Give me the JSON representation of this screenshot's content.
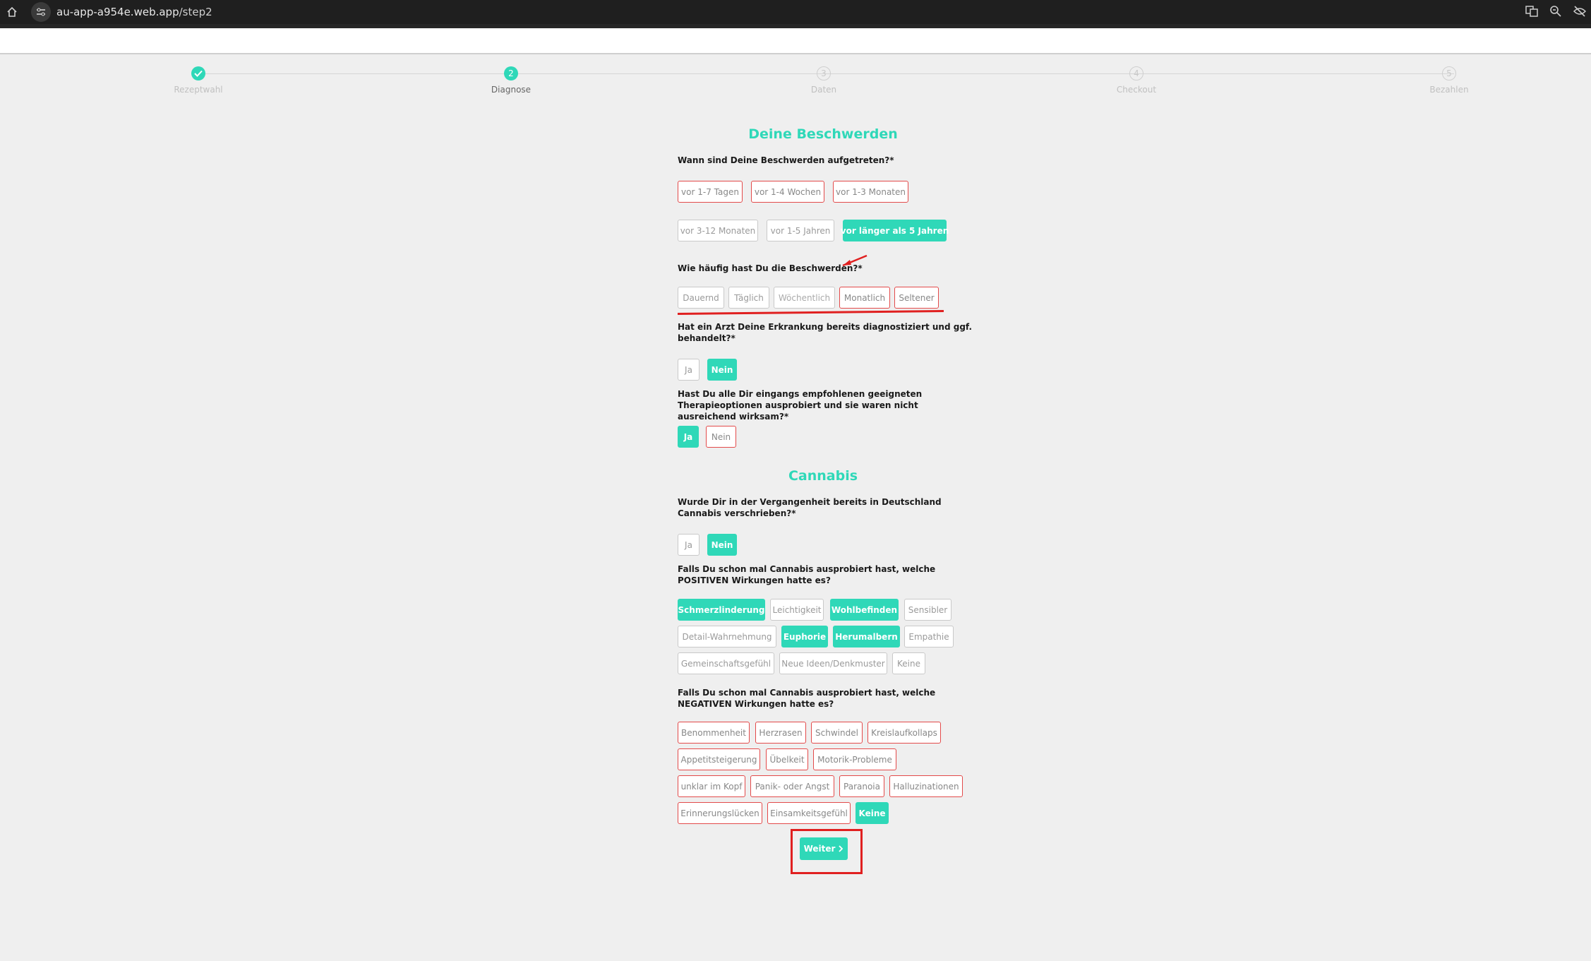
{
  "browser": {
    "url_host": "au-app-a954e.web.app",
    "url_path": "/step2"
  },
  "stepper": {
    "steps": [
      {
        "num": "✓",
        "label": "Rezeptwahl",
        "state": "done"
      },
      {
        "num": "2",
        "label": "Diagnose",
        "state": "active"
      },
      {
        "num": "3",
        "label": "Daten",
        "state": "pending"
      },
      {
        "num": "4",
        "label": "Checkout",
        "state": "pending"
      },
      {
        "num": "5",
        "label": "Bezahlen",
        "state": "pending"
      }
    ]
  },
  "complaints": {
    "title": "Deine Beschwerden",
    "q_when": "Wann sind Deine Beschwerden aufgetreten?*",
    "when_options": [
      "vor 1-7 Tagen",
      "vor 1-4 Wochen",
      "vor 1-3 Monaten",
      "vor 3-12 Monaten",
      "vor 1-5 Jahren",
      "vor länger als 5 Jahren"
    ],
    "q_freq": "Wie häufig hast Du die Beschwerden?*",
    "freq_options": [
      "Dauernd",
      "Täglich",
      "Wöchentlich",
      "Monatlich",
      "Seltener"
    ],
    "q_doctor": "Hat ein Arzt Deine Erkrankung bereits diagnostiziert und ggf. behandelt?*",
    "doctor_options": [
      "Ja",
      "Nein"
    ],
    "q_therapy": "Hast Du alle Dir eingangs empfohlenen geeigneten Therapieoptionen ausprobiert und sie waren nicht ausreichend wirksam?*",
    "therapy_options": [
      "Ja",
      "Nein"
    ]
  },
  "cannabis": {
    "title": "Cannabis",
    "q_prescribed": "Wurde Dir in der Vergangenheit bereits in Deutschland Cannabis verschrieben?*",
    "prescribed_options": [
      "Ja",
      "Nein"
    ],
    "q_positive": "Falls Du schon mal Cannabis ausprobiert hast, welche POSITIVEN Wirkungen hatte es?",
    "positive_options": [
      "Schmerzlinderung",
      "Leichtigkeit",
      "Wohlbefinden",
      "Sensibler",
      "Detail-Wahrnehmung",
      "Euphorie",
      "Herumalbern",
      "Empathie",
      "Gemeinschaftsgefühl",
      "Neue Ideen/Denkmuster",
      "Keine"
    ],
    "q_negative": "Falls Du schon mal Cannabis ausprobiert hast, welche NEGATIVEN Wirkungen hatte es?",
    "negative_options": [
      "Benommenheit",
      "Herzrasen",
      "Schwindel",
      "Kreislaufkollaps",
      "Appetitsteigerung",
      "Übelkeit",
      "Motorik-Probleme",
      "unklar im Kopf",
      "Panik- oder Angst",
      "Paranoia",
      "Halluzinationen",
      "Erinnerungslücken",
      "Einsamkeitsgefühl",
      "Keine"
    ]
  },
  "next_button": "Weiter",
  "colors": {
    "accent": "#2fd8b8",
    "annotation": "#e02020"
  }
}
